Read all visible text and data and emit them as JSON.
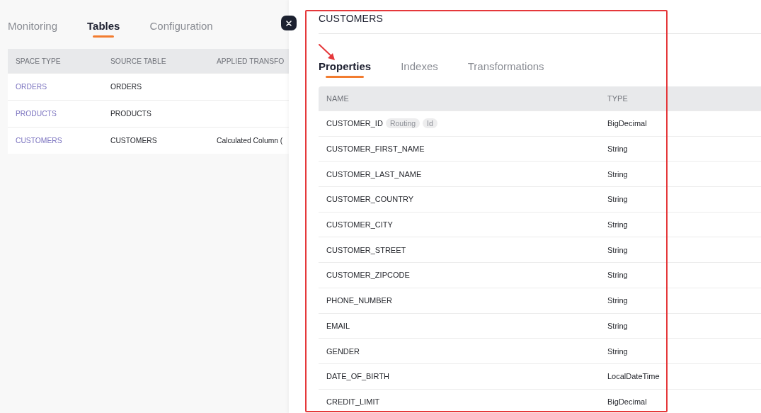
{
  "left": {
    "tabs": [
      {
        "label": "Monitoring",
        "selected": false
      },
      {
        "label": "Tables",
        "selected": true
      },
      {
        "label": "Configuration",
        "selected": false
      }
    ],
    "table": {
      "columns": [
        "SPACE TYPE",
        "SOURCE TABLE",
        "APPLIED TRANSFO"
      ],
      "rows": [
        [
          "ORDERS",
          "ORDERS",
          ""
        ],
        [
          "PRODUCTS",
          "PRODUCTS",
          ""
        ],
        [
          "CUSTOMERS",
          "CUSTOMERS",
          "Calculated Column ("
        ]
      ]
    }
  },
  "panel": {
    "title": "CUSTOMERS",
    "tabs": [
      {
        "label": "Properties",
        "selected": true
      },
      {
        "label": "Indexes",
        "selected": false
      },
      {
        "label": "Transformations",
        "selected": false
      }
    ],
    "table": {
      "columns": [
        "NAME",
        "TYPE"
      ],
      "rows": [
        {
          "name": "CUSTOMER_ID",
          "tags": [
            "Routing",
            "Id"
          ],
          "type": "BigDecimal"
        },
        {
          "name": "CUSTOMER_FIRST_NAME",
          "type": "String"
        },
        {
          "name": "CUSTOMER_LAST_NAME",
          "type": "String"
        },
        {
          "name": "CUSTOMER_COUNTRY",
          "type": "String"
        },
        {
          "name": "CUSTOMER_CITY",
          "type": "String"
        },
        {
          "name": "CUSTOMER_STREET",
          "type": "String"
        },
        {
          "name": "CUSTOMER_ZIPCODE",
          "type": "String"
        },
        {
          "name": "PHONE_NUMBER",
          "type": "String"
        },
        {
          "name": "EMAIL",
          "type": "String"
        },
        {
          "name": "GENDER",
          "type": "String"
        },
        {
          "name": "DATE_OF_BIRTH",
          "type": "LocalDateTime"
        },
        {
          "name": "CREDIT_LIMIT",
          "type": "BigDecimal"
        }
      ]
    }
  },
  "annotations": {
    "highlight_box": true,
    "arrow": true
  }
}
